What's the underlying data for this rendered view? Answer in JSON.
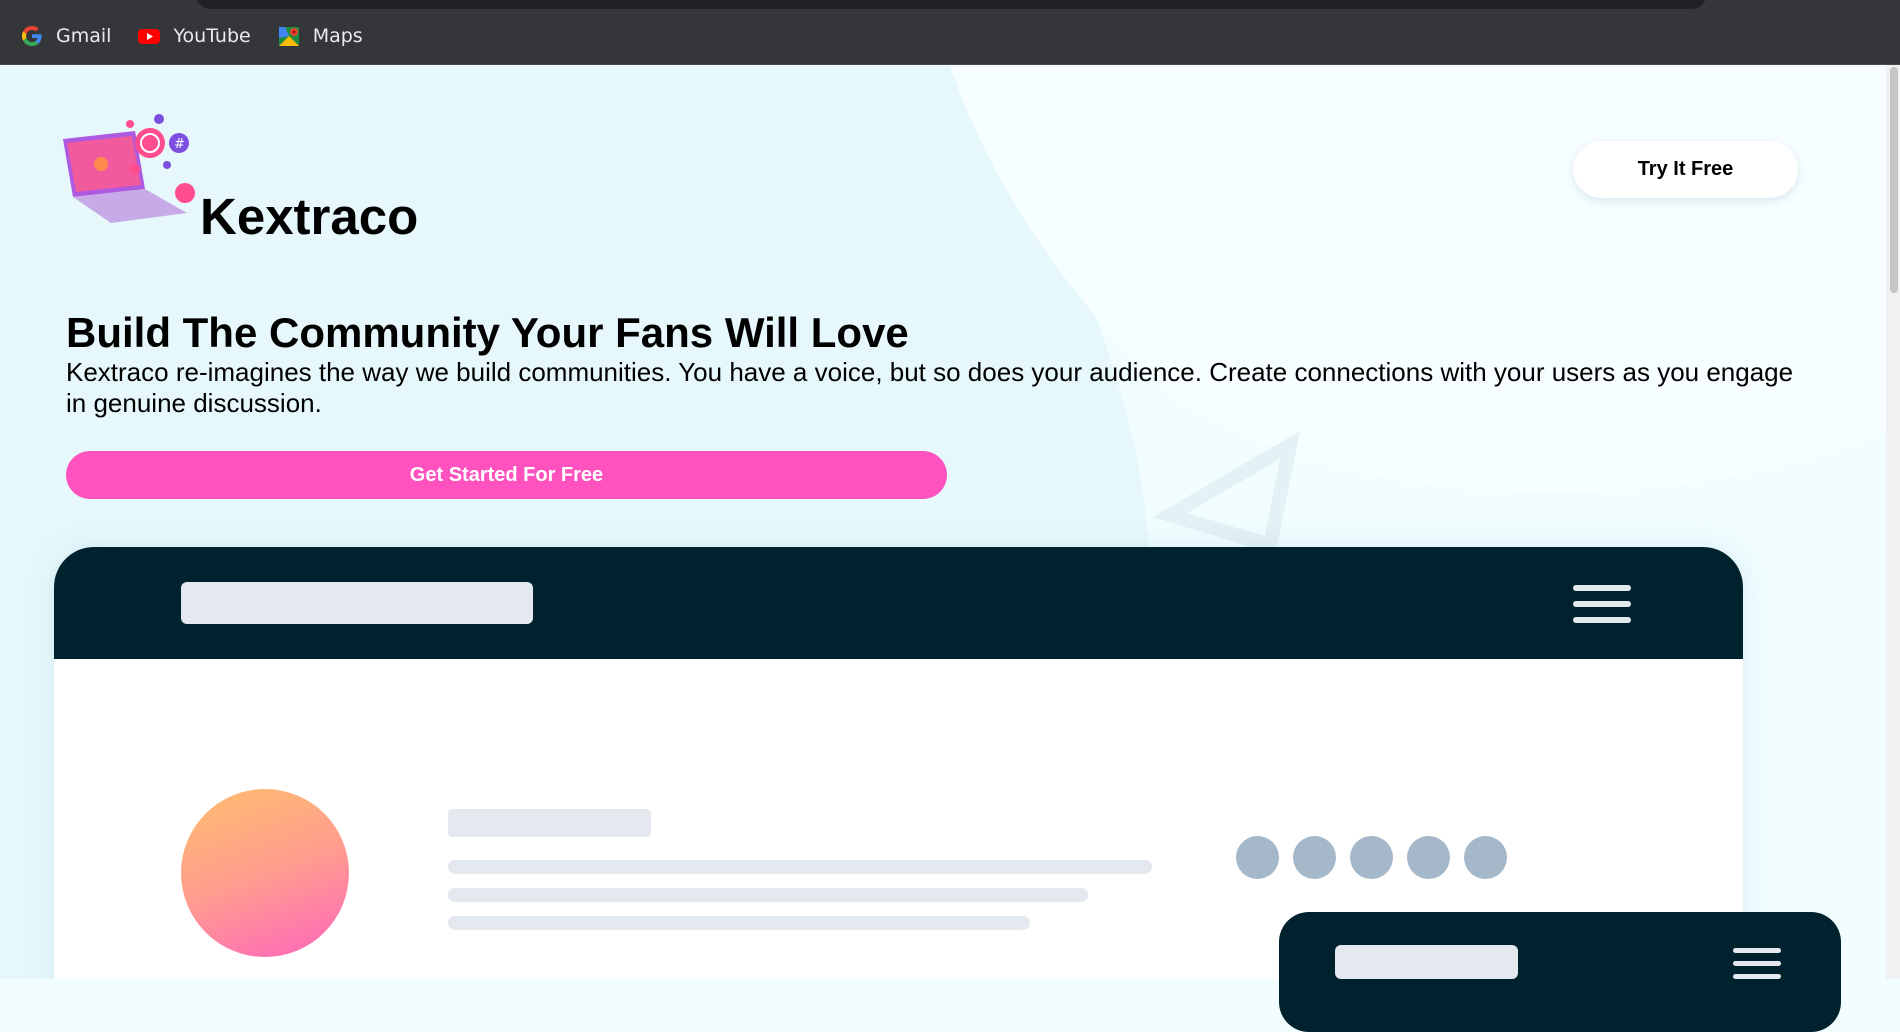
{
  "bookmarks": [
    {
      "label": "Gmail",
      "icon": "google-icon"
    },
    {
      "label": "YouTube",
      "icon": "youtube-icon"
    },
    {
      "label": "Maps",
      "icon": "maps-icon"
    }
  ],
  "header": {
    "brand": "Kextraco",
    "try_button": "Try It Free"
  },
  "hero": {
    "title": "Build The Community Your Fans Will Love",
    "description": "Kextraco re-imagines the way we build communities. You have a voice, but so does your audience. Create connections with your users as you engage in genuine discussion.",
    "cta": "Get Started For Free"
  },
  "colors": {
    "page_background": "#f1fdff",
    "cta_pink": "#ff52bf",
    "mockup_dark": "#00222e",
    "skeleton_gray": "#e3e9ee",
    "dot_gray": "#a4b8c9"
  }
}
